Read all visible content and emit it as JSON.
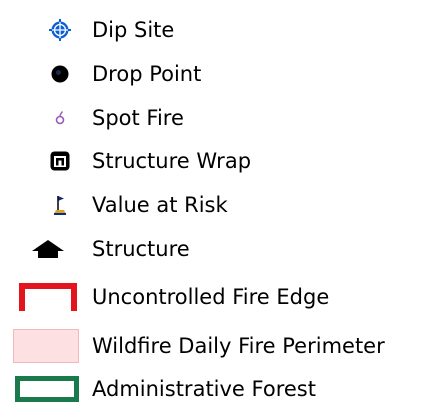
{
  "legend": {
    "items": [
      {
        "label": "Dip Site",
        "icon": "dip-site-icon",
        "color": "#0b5fd6"
      },
      {
        "label": "Drop Point",
        "icon": "drop-point-icon",
        "color": "#000000"
      },
      {
        "label": "Spot Fire",
        "icon": "spot-fire-icon",
        "color": "#9b59b6"
      },
      {
        "label": "Structure Wrap",
        "icon": "structure-wrap-icon",
        "color": "#000000"
      },
      {
        "label": "Value at Risk",
        "icon": "value-at-risk-icon",
        "color": "#0a2a8c"
      },
      {
        "label": "Structure",
        "icon": "structure-icon",
        "color": "#000000"
      },
      {
        "label": "Uncontrolled Fire Edge",
        "icon": "uncontrolled-fire-edge-icon",
        "color": "#e3141b"
      },
      {
        "label": "Wildfire Daily Fire Perimeter",
        "icon": "wildfire-perimeter-icon",
        "color": "#fde0e2"
      },
      {
        "label": "Administrative Forest",
        "icon": "administrative-forest-icon",
        "color": "#1a7a4c"
      }
    ]
  }
}
